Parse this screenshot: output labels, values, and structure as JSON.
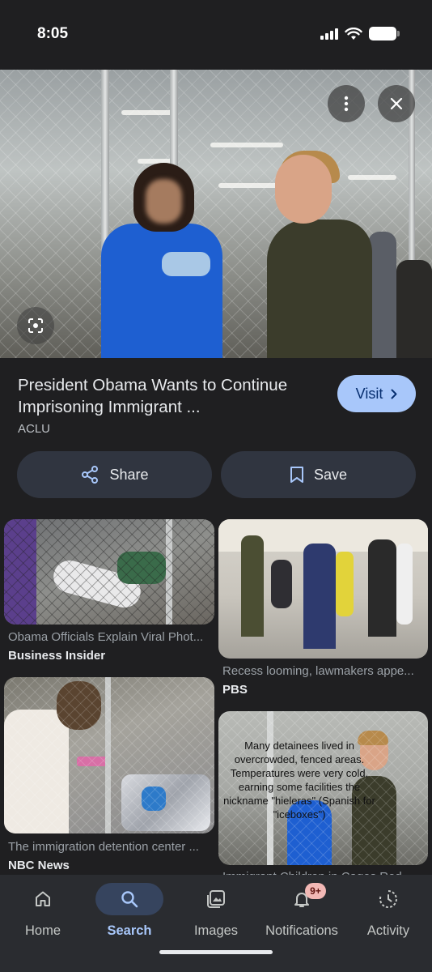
{
  "status_bar": {
    "time": "8:05"
  },
  "result": {
    "title": "President Obama Wants to Continue Imprisoning Immigrant ...",
    "source": "ACLU",
    "visit_label": "Visit"
  },
  "actions": {
    "share_label": "Share",
    "save_label": "Save"
  },
  "related": [
    {
      "caption": "Obama Officials Explain Viral Phot...",
      "source": "Business Insider"
    },
    {
      "caption": "Recess looming, lawmakers appe...",
      "source": "PBS"
    },
    {
      "caption": "The immigration detention center ...",
      "source": "NBC News"
    },
    {
      "caption": "Immigrant Children in Cages Red...",
      "source": "",
      "overlay_text": "Many detainees lived in overcrowded, fenced areas. Temperatures were very cold, earning some facilities the nickname \"hieleras\" (Spanish for \"iceboxes\")"
    }
  ],
  "nav": {
    "home": "Home",
    "search": "Search",
    "images": "Images",
    "notifications": "Notifications",
    "notifications_badge": "9+",
    "activity": "Activity"
  },
  "colors": {
    "accent": "#a8c7fa",
    "background": "#1f1f21",
    "chip": "#303540"
  }
}
